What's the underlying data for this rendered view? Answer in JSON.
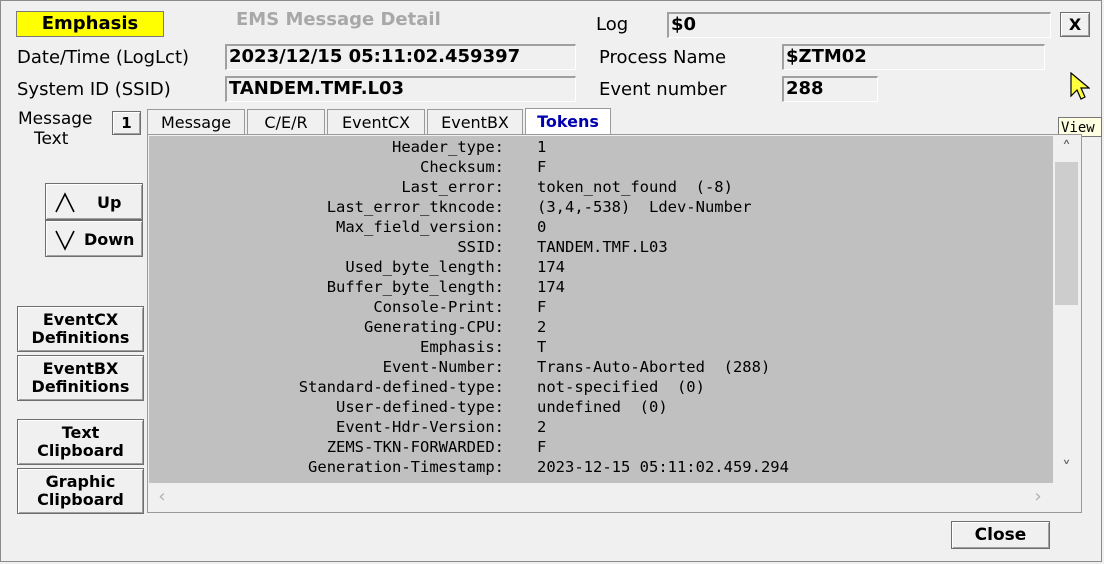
{
  "window": {
    "emphasis_label": "Emphasis",
    "title": "EMS Message Detail",
    "close_x": "X"
  },
  "header": {
    "log_label": "Log",
    "log_value": "$0",
    "datetime_label": "Date/Time (LogLct)",
    "datetime_value": "2023/12/15 05:11:02.459397",
    "process_label": "Process Name",
    "process_value": "$ZTM02",
    "ssid_label": "System ID (SSID)",
    "ssid_value": "TANDEM.TMF.L03",
    "event_label": "Event number",
    "event_value": "288"
  },
  "left": {
    "message_text_label_1": "Message",
    "message_text_label_2": "Text",
    "message_count": "1",
    "up_label": "Up",
    "down_label": "Down",
    "eventcx_label_1": "EventCX",
    "eventcx_label_2": "Definitions",
    "eventbx_label_1": "EventBX",
    "eventbx_label_2": "Definitions",
    "text_clip_1": "Text",
    "text_clip_2": "Clipboard",
    "graphic_clip_1": "Graphic",
    "graphic_clip_2": "Clipboard"
  },
  "tabs": [
    {
      "label": "Message"
    },
    {
      "label": "C/E/R"
    },
    {
      "label": "EventCX"
    },
    {
      "label": "EventBX"
    },
    {
      "label": "Tokens"
    }
  ],
  "tokens": [
    {
      "key": "Header_type:",
      "value": "1"
    },
    {
      "key": "Checksum:",
      "value": "F"
    },
    {
      "key": "Last_error:",
      "value": "token_not_found  (-8)"
    },
    {
      "key": "Last_error_tkncode:",
      "value": "(3,4,-538)  Ldev-Number"
    },
    {
      "key": "Max_field_version:",
      "value": "0"
    },
    {
      "key": "SSID:",
      "value": "TANDEM.TMF.L03"
    },
    {
      "key": "Used_byte_length:",
      "value": "174"
    },
    {
      "key": "Buffer_byte_length:",
      "value": "174"
    },
    {
      "key": "Console-Print:",
      "value": "F"
    },
    {
      "key": "Generating-CPU:",
      "value": "2"
    },
    {
      "key": "Emphasis:",
      "value": "T"
    },
    {
      "key": "Event-Number:",
      "value": "Trans-Auto-Aborted  (288)"
    },
    {
      "key": "Standard-defined-type:",
      "value": "not-specified  (0)"
    },
    {
      "key": "User-defined-type:",
      "value": "undefined  (0)"
    },
    {
      "key": "Event-Hdr-Version:",
      "value": "2"
    },
    {
      "key": "ZEMS-TKN-FORWARDED:",
      "value": "F"
    },
    {
      "key": "Generation-Timestamp:",
      "value": "2023-12-15 05:11:02.459.294"
    }
  ],
  "footer": {
    "close_label": "Close"
  },
  "tooltip": {
    "text": "View"
  }
}
